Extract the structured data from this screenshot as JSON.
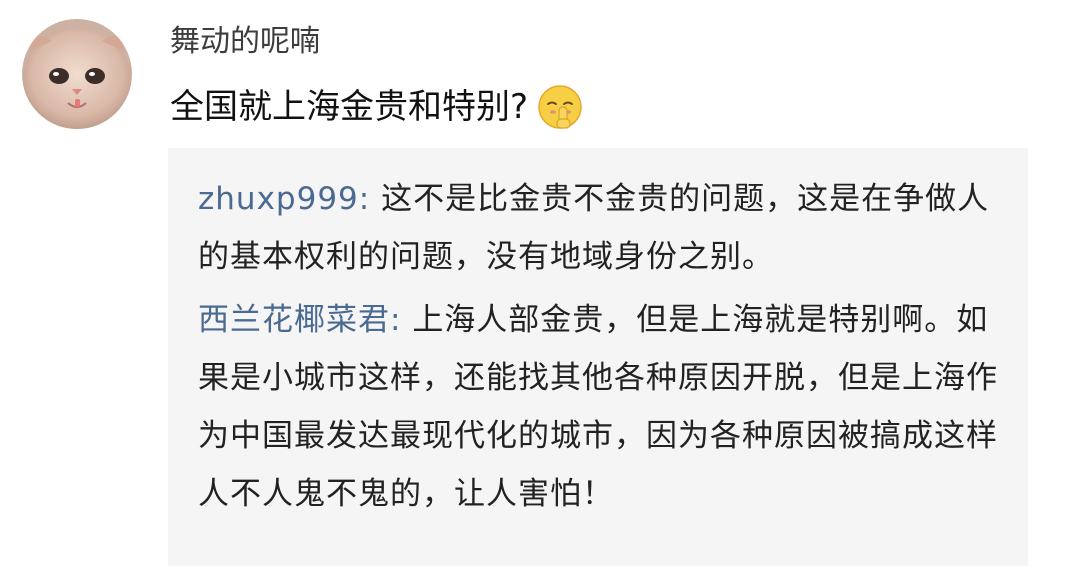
{
  "comment": {
    "username": "舞动的呢喃",
    "text": "全国就上海金贵和特别?",
    "emoji": "shush-emoji-icon"
  },
  "replies": [
    {
      "author": "zhuxp999",
      "text": "这不是比金贵不金贵的问题，这是在争做人的基本权利的问题，没有地域身份之别。"
    },
    {
      "author": "西兰花椰菜君",
      "text": "上海人部金贵，但是上海就是特别啊。如果是小城市这样，还能找其他各种原因开脱，但是上海作为中国最发达最现代化的城市，因为各种原因被搞成这样人不人鬼不鬼的，让人害怕！"
    }
  ],
  "colors": {
    "author_link": "#4b6a91",
    "reply_background": "#f5f5f5",
    "text": "#111111"
  }
}
